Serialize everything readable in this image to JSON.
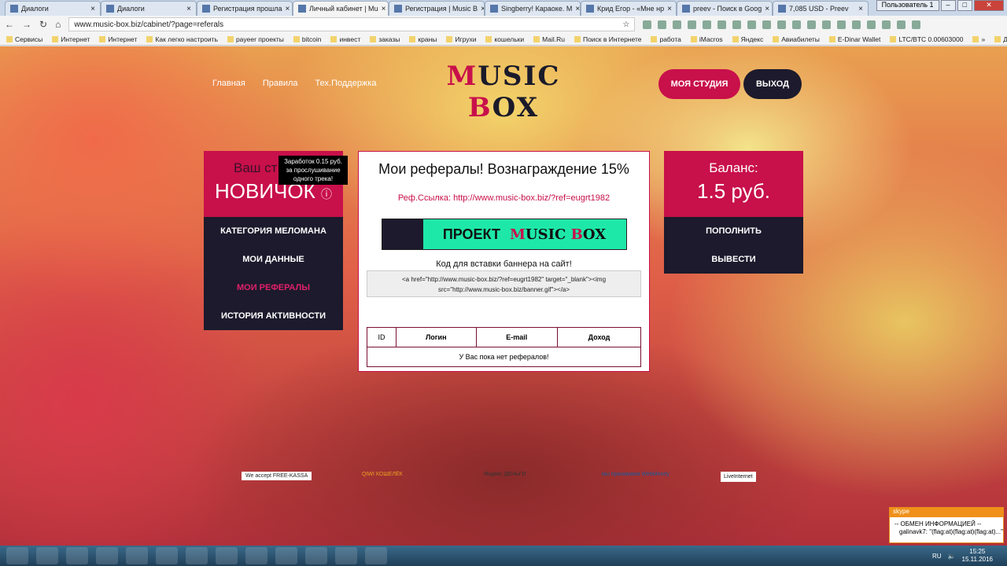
{
  "browser": {
    "tabs": [
      {
        "label": "Диалоги"
      },
      {
        "label": "Диалоги"
      },
      {
        "label": "Регистрация прошла"
      },
      {
        "label": "Личный кабинет | Mu",
        "active": true
      },
      {
        "label": "Регистрация | Music B"
      },
      {
        "label": "Singberry! Караоке. M"
      },
      {
        "label": "Крид Егор - «Мне нр"
      },
      {
        "label": "preev - Поиск в Goog"
      },
      {
        "label": "7,085 USD - Preev"
      }
    ],
    "user": "Пользователь 1",
    "url": "www.music-box.biz/cabinet/?page=referals",
    "bookmarks": [
      "Сервисы",
      "Интернет",
      "Интернет",
      "Как легко настроить",
      "payeer проекты",
      "bitcoin",
      "инвест",
      "заказы",
      "краны",
      "Игрухи",
      "кошельки",
      "Mail.Ru",
      "Поиск в Интернете",
      "работа",
      "iMacros",
      "Яндекс",
      "Авиабилеты",
      "E-Dinar Wallet",
      "LTC/BTC 0.00603000",
      "»",
      "Другие закладки"
    ]
  },
  "site": {
    "menu": [
      "Главная",
      "Правила",
      "Тех.Поддержка"
    ],
    "logo": {
      "line1": "MUSIC",
      "line2": "BOX"
    },
    "studio_button": "МОЯ СТУДИЯ",
    "exit_button": "ВЫХОД",
    "status": {
      "label": "Ваш ст",
      "value": "НОВИЧОК",
      "tooltip": "Заработок 0.15 руб. за прослушивание одного трека!"
    },
    "left_menu": [
      "КАТЕГОРИЯ МЕЛОМАНА",
      "МОИ ДАННЫЕ",
      "МОИ РЕФЕРАЛЫ",
      "ИСТОРИЯ АКТИВНОСТИ"
    ],
    "referrals": {
      "title": "Мои рефералы! Вознаграждение 15%",
      "ref_label": "Реф.Ссылка:",
      "ref_link": "http://www.music-box.biz/?ref=eugrt1982",
      "banner": {
        "text": "ПРОЕКТ",
        "brand": "MUSIC BOX"
      },
      "code_label": "Код для вставки баннера на сайт!",
      "code": "<a href=\"http://www.music-box.biz/?ref=eugrt1982\" target=\"_blank\"><img src=\"http://www.music-box.biz/banner.gif\"></a>",
      "columns": [
        "ID",
        "Логин",
        "E-mail",
        "Доход"
      ],
      "empty": "У Вас пока нет рефералов!"
    },
    "balance": {
      "label": "Баланс:",
      "value": "1.5 руб.",
      "deposit": "ПОПОЛНИТЬ",
      "withdraw": "ВЫВЕСТИ"
    },
    "payments": [
      "We accept FREE-KASSA",
      "QIWI КОШЕЛЁК",
      "Яндекс ДЕНЬГИ",
      "мы принимаем WebMoney",
      "LiveInternet"
    ]
  },
  "skype": {
    "header": "skype",
    "line1": "-- ОБМЕН ИНФОРМАЦИЕЙ --",
    "line2": "galinavk7: \"(flag:at)(flag:at)(flag:at)...\""
  },
  "tray": {
    "lang": "RU",
    "time": "15:25",
    "date": "15.11.2016"
  }
}
